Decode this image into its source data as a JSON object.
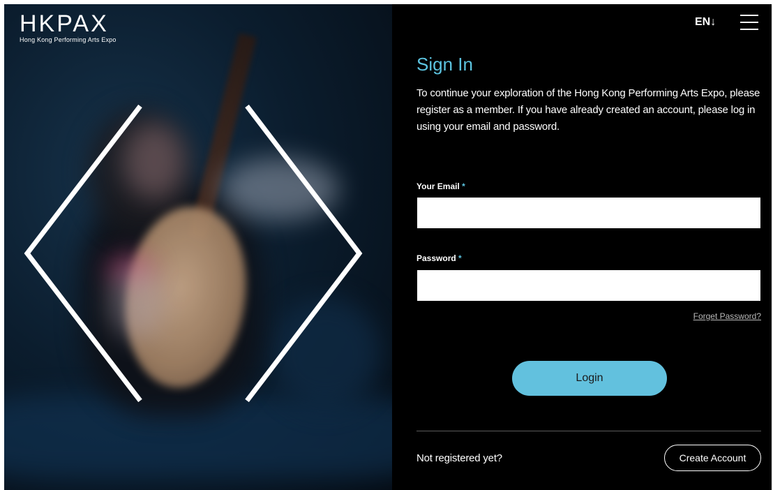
{
  "header": {
    "logo_mark": "HKPAX",
    "logo_subtitle": "Hong Kong Performing Arts Expo",
    "language_label": "EN",
    "language_arrow": "↓"
  },
  "signin": {
    "title": "Sign In",
    "intro": "To continue your exploration of the Hong Kong Performing Arts Expo, please register as a member. If you have already created an account, please log in using your email and password.",
    "email_label": "Your Email",
    "email_value": "",
    "password_label": "Password",
    "password_value": "",
    "required_marker": "*",
    "forgot_password": "Forget Password?",
    "login_button": "Login"
  },
  "register": {
    "prompt": "Not registered yet?",
    "create_button": "Create Account"
  },
  "icons": {
    "menu": "hamburger-menu-icon",
    "language": "arrow-down-icon"
  },
  "colors": {
    "accent": "#5cc3df",
    "login_button": "#62c1de",
    "panel_background": "#000000"
  }
}
